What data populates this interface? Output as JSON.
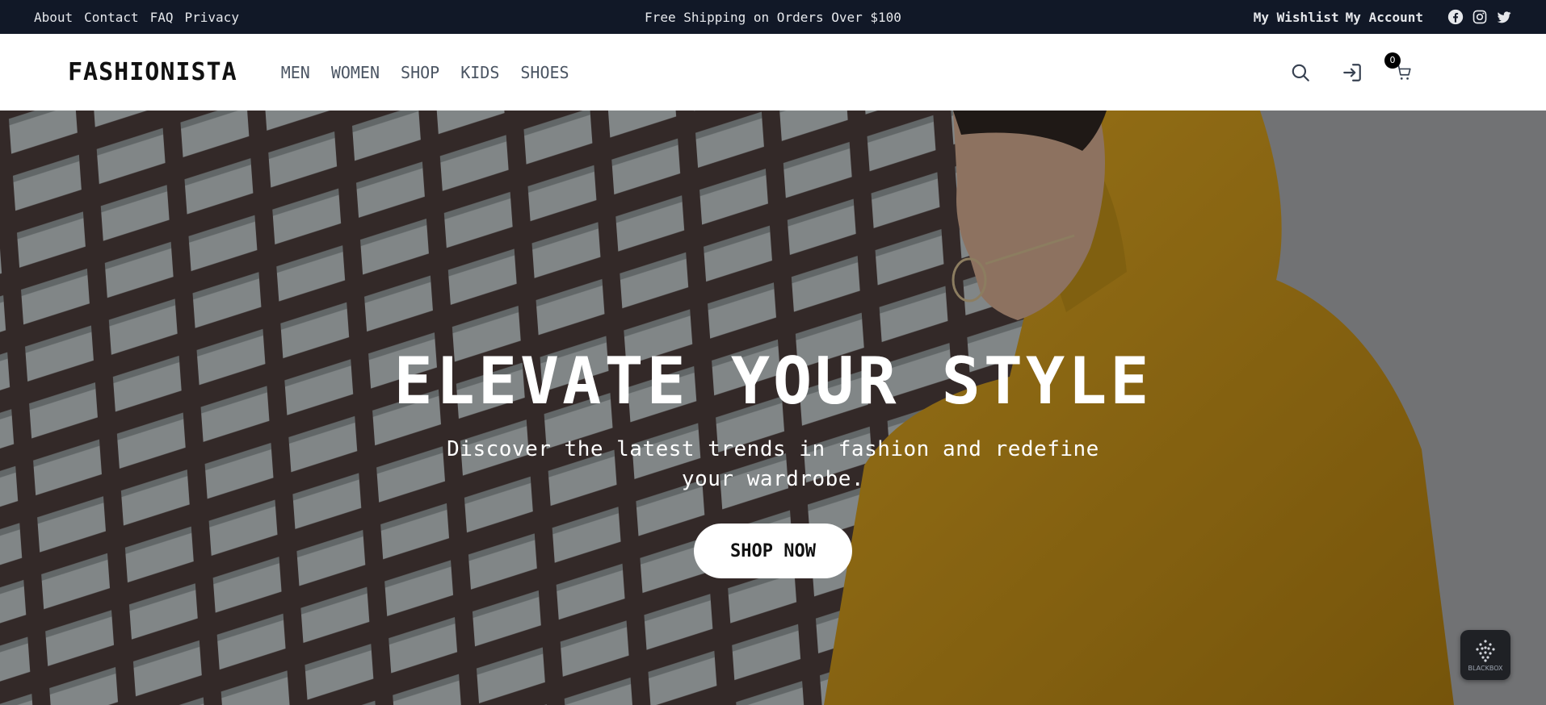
{
  "topbar": {
    "links": [
      "About",
      "Contact",
      "FAQ",
      "Privacy"
    ],
    "promo": "Free Shipping on Orders Over $100",
    "wishlist": "My Wishlist",
    "account": "My Account",
    "social_icons": [
      "facebook-icon",
      "instagram-icon",
      "twitter-icon"
    ]
  },
  "header": {
    "logo": "FASHIONISTA",
    "nav": [
      "MEN",
      "WOMEN",
      "SHOP",
      "KIDS",
      "SHOES"
    ],
    "icons": [
      "search-icon",
      "login-icon",
      "cart-icon"
    ],
    "cart_count": "0"
  },
  "hero": {
    "title": "ELEVATE YOUR STYLE",
    "subtitle": "Discover the latest trends in fashion and redefine your wardrobe.",
    "cta": "SHOP NOW"
  },
  "widget": {
    "label": "BLACKBOX"
  },
  "colors": {
    "topbar_bg": "#111827",
    "hero_overlay": "#000000",
    "hoodie": "#c8961a"
  }
}
